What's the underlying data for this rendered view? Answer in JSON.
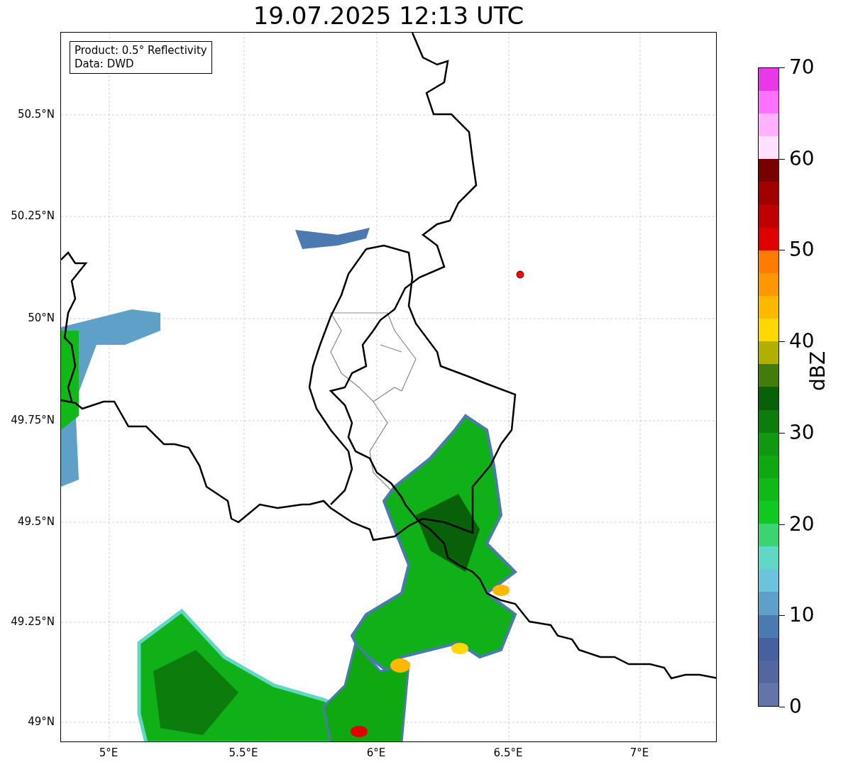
{
  "title": "19.07.2025 12:13 UTC",
  "legend": {
    "lines": [
      "Product: 0.5° Reflectivity",
      "Data: DWD"
    ]
  },
  "y_tick_labels": [
    "50.5°N",
    "50.25°N",
    "50°N",
    "49.75°N",
    "49.5°N",
    "49.25°N",
    "49°N"
  ],
  "x_tick_labels": [
    "5°E",
    "5.5°E",
    "6°E",
    "6.5°E",
    "7°E"
  ],
  "colorbar": {
    "label": "dBZ",
    "tick_labels": [
      "70",
      "60",
      "50",
      "40",
      "30",
      "20",
      "10",
      "0"
    ],
    "bins": [
      {
        "color": "#6474a8"
      },
      {
        "color": "#5366a0"
      },
      {
        "color": "#4660a0"
      },
      {
        "color": "#4a7ab0"
      },
      {
        "color": "#5ea0c8"
      },
      {
        "color": "#6ac4dc"
      },
      {
        "color": "#60d8c4"
      },
      {
        "color": "#3cd470"
      },
      {
        "color": "#10c820"
      },
      {
        "color": "#10b818"
      },
      {
        "color": "#10a810"
      },
      {
        "color": "#109810"
      },
      {
        "color": "#0c7c0c"
      },
      {
        "color": "#086008"
      },
      {
        "color": "#447c0c"
      },
      {
        "color": "#b0b000"
      },
      {
        "color": "#ffd800"
      },
      {
        "color": "#ffb800"
      },
      {
        "color": "#ff9800"
      },
      {
        "color": "#ff7c00"
      },
      {
        "color": "#e00000"
      },
      {
        "color": "#c00000"
      },
      {
        "color": "#a00000"
      },
      {
        "color": "#780000"
      },
      {
        "color": "#ffe0ff"
      },
      {
        "color": "#ffb0ff"
      },
      {
        "color": "#ff70ff"
      },
      {
        "color": "#e838e8"
      }
    ]
  }
}
